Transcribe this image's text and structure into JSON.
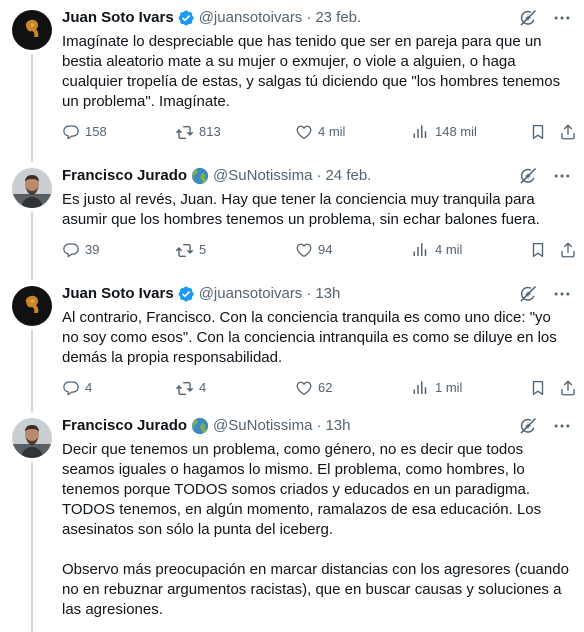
{
  "tweets": [
    {
      "name": "Juan Soto Ivars",
      "handle": "@juansotoivars",
      "dot": "·",
      "time": "23 feb.",
      "text": "Imagínate lo despreciable que has tenido que ser en pareja para que un bestia aleatorio mate a su mujer o exmujer, o viole a alguien, o haga cualquier tropelía de estas, y salgas tú diciendo que \"los hombres tenemos un problema\". Imagínate.",
      "replies": "158",
      "retweets": "813",
      "likes": "4 mil",
      "views": "148 mil"
    },
    {
      "name": "Francisco Jurado",
      "handle": "@SuNotissima",
      "dot": "·",
      "time": "24 feb.",
      "text": "Es justo al revés, Juan. Hay que tener la conciencia muy tranquila para asumir que los hombres tenemos un problema, sin echar balones fuera.",
      "replies": "39",
      "retweets": "5",
      "likes": "94",
      "views": "4 mil"
    },
    {
      "name": "Juan Soto Ivars",
      "handle": "@juansotoivars",
      "dot": "·",
      "time": "13h",
      "text": "Al contrario, Francisco. Con la conciencia tranquila es como uno dice: \"yo no soy como esos\". Con la conciencia intranquila es como se diluye en los demás la propia responsabilidad.",
      "replies": "4",
      "retweets": "4",
      "likes": "62",
      "views": "1 mil"
    },
    {
      "name": "Francisco Jurado",
      "handle": "@SuNotissima",
      "dot": "·",
      "time": "13h",
      "text": "Decir que tenemos un problema, como género, no es decir que todos seamos iguales o hagamos lo mismo. El problema, como hombres, lo tenemos porque TODOS somos criados y educados en un paradigma. TODOS tenemos, en algún momento, ramalazos de esa educación. Los asesinatos son sólo la punta del iceberg.\n\nObservo más preocupación en marcar distancias con los agresores (cuando no en rebuznar argumentos racistas), que en buscar causas y soluciones a las agresiones."
    }
  ],
  "colors": {
    "text": "#0f1419",
    "secondary": "#536471",
    "verified": "#1d9bf0",
    "thread_line": "#cfd9de"
  },
  "icons": {
    "verified": "verified-badge-icon",
    "globe": "globe-emoji-icon",
    "grok": "grok-icon",
    "more": "more-icon",
    "reply": "reply-icon",
    "retweet": "retweet-icon",
    "like": "heart-icon",
    "views": "views-icon",
    "bookmark": "bookmark-icon",
    "share": "share-icon"
  }
}
